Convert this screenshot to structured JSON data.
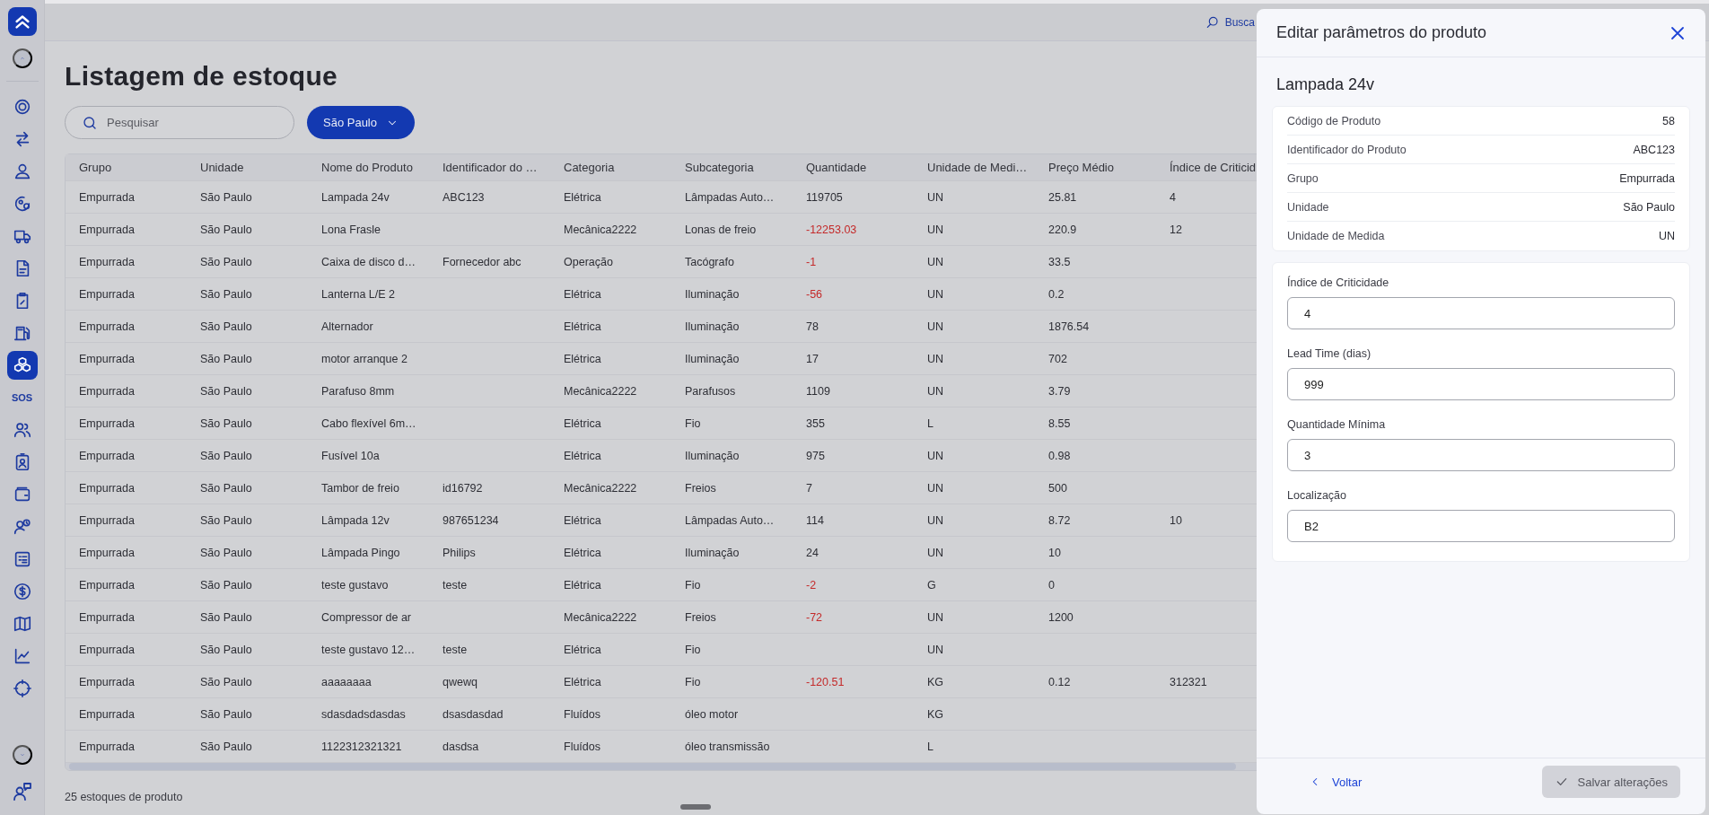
{
  "sidebar": {
    "nav": [
      {
        "selected": false
      },
      {
        "selected": false
      },
      {
        "selected": false
      },
      {
        "selected": false
      },
      {
        "selected": false
      },
      {
        "selected": false
      },
      {
        "selected": false
      },
      {
        "selected": false
      },
      {
        "selected": true
      },
      {
        "selected": false,
        "label": "SOS"
      },
      {
        "selected": false
      },
      {
        "selected": false
      },
      {
        "selected": false
      },
      {
        "selected": false
      },
      {
        "selected": false
      },
      {
        "selected": false
      },
      {
        "selected": false
      },
      {
        "selected": false
      },
      {
        "selected": false
      }
    ]
  },
  "topbar": {
    "search_link": "Busca"
  },
  "page": {
    "title": "Listagem de estoque",
    "search": {
      "placeholder": "Pesquisar"
    },
    "unit_filter": "São Paulo"
  },
  "table": {
    "columns": [
      "Grupo",
      "Unidade",
      "Nome do Produto",
      "Identificador do …",
      "Categoria",
      "Subcategoria",
      "Quantidade",
      "Unidade de Medi…",
      "Preço Médio",
      "Índice de Criticid"
    ],
    "rows": [
      {
        "cells": [
          "Empurrada",
          "São Paulo",
          "Lampada 24v",
          "ABC123",
          "Elétrica",
          "Lâmpadas Auto…",
          "119705",
          "UN",
          "25.81",
          "4"
        ],
        "negative": false
      },
      {
        "cells": [
          "Empurrada",
          "São Paulo",
          "Lona Frasle",
          null,
          "Mecânica2222",
          "Lonas de freio",
          "-12253.03",
          "UN",
          "220.9",
          "12"
        ],
        "negative": true
      },
      {
        "cells": [
          "Empurrada",
          "São Paulo",
          "Caixa de disco d…",
          "Fornecedor abc",
          "Operação",
          "Tacógrafo",
          "-1",
          "UN",
          "33.5",
          null
        ],
        "negative": true
      },
      {
        "cells": [
          "Empurrada",
          "São Paulo",
          "Lanterna L/E 2",
          null,
          "Elétrica",
          "Iluminação",
          "-56",
          "UN",
          "0.2",
          null
        ],
        "negative": true
      },
      {
        "cells": [
          "Empurrada",
          "São Paulo",
          "Alternador",
          null,
          "Elétrica",
          "Iluminação",
          "78",
          "UN",
          "1876.54",
          null
        ],
        "negative": false
      },
      {
        "cells": [
          "Empurrada",
          "São Paulo",
          "motor arranque 2",
          null,
          "Elétrica",
          "Iluminação",
          "17",
          "UN",
          "702",
          null
        ],
        "negative": false
      },
      {
        "cells": [
          "Empurrada",
          "São Paulo",
          "Parafuso 8mm",
          null,
          "Mecânica2222",
          "Parafusos",
          "1109",
          "UN",
          "3.79",
          null
        ],
        "negative": false
      },
      {
        "cells": [
          "Empurrada",
          "São Paulo",
          "Cabo flexível 6m…",
          null,
          "Elétrica",
          "Fio",
          "355",
          "L",
          "8.55",
          null
        ],
        "negative": false
      },
      {
        "cells": [
          "Empurrada",
          "São Paulo",
          "Fusível 10a",
          null,
          "Elétrica",
          "Iluminação",
          "975",
          "UN",
          "0.98",
          null
        ],
        "negative": false
      },
      {
        "cells": [
          "Empurrada",
          "São Paulo",
          "Tambor de freio",
          "id16792",
          "Mecânica2222",
          "Freios",
          "7",
          "UN",
          "500",
          null
        ],
        "negative": false
      },
      {
        "cells": [
          "Empurrada",
          "São Paulo",
          "Lâmpada 12v",
          "987651234",
          "Elétrica",
          "Lâmpadas Auto…",
          "114",
          "UN",
          "8.72",
          "10"
        ],
        "negative": false
      },
      {
        "cells": [
          "Empurrada",
          "São Paulo",
          "Lâmpada Pingo",
          "Philips",
          "Elétrica",
          "Iluminação",
          "24",
          "UN",
          "10",
          null
        ],
        "negative": false
      },
      {
        "cells": [
          "Empurrada",
          "São Paulo",
          "teste gustavo",
          "teste",
          "Elétrica",
          "Fio",
          "-2",
          "G",
          "0",
          null
        ],
        "negative": true
      },
      {
        "cells": [
          "Empurrada",
          "São Paulo",
          "Compressor de ar",
          null,
          "Mecânica2222",
          "Freios",
          "-72",
          "UN",
          "1200",
          null
        ],
        "negative": true
      },
      {
        "cells": [
          "Empurrada",
          "São Paulo",
          "teste gustavo 12…",
          "teste",
          "Elétrica",
          "Fio",
          null,
          "UN",
          null,
          null
        ]
      },
      {
        "cells": [
          "Empurrada",
          "São Paulo",
          "aaaaaaaa",
          "qwewq",
          "Elétrica",
          "Fio",
          "-120.51",
          "KG",
          "0.12",
          "312321"
        ],
        "negative": true
      },
      {
        "cells": [
          "Empurrada",
          "São Paulo",
          "sdasdadsdasdas",
          "dsasdasdad",
          "Fluídos",
          "óleo motor",
          null,
          "KG",
          null,
          null
        ]
      },
      {
        "cells": [
          "Empurrada",
          "São Paulo",
          "1122312321321",
          "dasdsa",
          "Fluídos",
          "óleo transmissão",
          null,
          "L",
          null,
          null
        ]
      }
    ]
  },
  "footer": {
    "count": "25 estoques de produto"
  },
  "drawer": {
    "title": "Editar parâmetros do produto",
    "product": "Lampada 24v",
    "details": [
      {
        "label": "Código de Produto",
        "value": "58"
      },
      {
        "label": "Identificador do Produto",
        "value": "ABC123"
      },
      {
        "label": "Grupo",
        "value": "Empurrada"
      },
      {
        "label": "Unidade",
        "value": "São Paulo"
      },
      {
        "label": "Unidade de Medida",
        "value": "UN"
      }
    ],
    "fields": [
      {
        "label": "Índice de Criticidade",
        "value": "4"
      },
      {
        "label": "Lead Time (dias)",
        "value": "999"
      },
      {
        "label": "Quantidade Mínima",
        "value": "3"
      },
      {
        "label": "Localização",
        "value": "B2"
      }
    ],
    "back": "Voltar",
    "save": {
      "label": "Salvar alterações",
      "disabled": true
    }
  }
}
